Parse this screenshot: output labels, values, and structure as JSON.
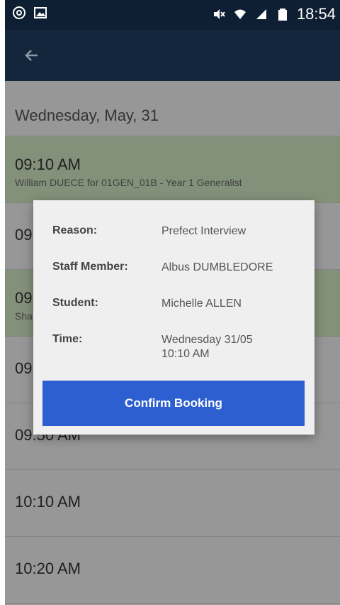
{
  "status_bar": {
    "time": "18:54",
    "icons": [
      "app-icon",
      "image-icon",
      "mute-icon",
      "wifi-icon",
      "signal-icon",
      "battery-icon"
    ]
  },
  "app_bar": {
    "back_icon": "arrow-left-icon"
  },
  "schedule": {
    "date": "Wednesday, May, 31",
    "slots": [
      {
        "time": "09:10 AM",
        "description": "William DUECE for 01GEN_01B - Year 1 Generalist",
        "booked": true
      },
      {
        "time": "09",
        "description": "",
        "booked": false
      },
      {
        "time": "09",
        "description": "Sha",
        "booked": true
      },
      {
        "time": "09",
        "description": "",
        "booked": false
      },
      {
        "time": "09:50 AM",
        "description": "",
        "booked": false
      },
      {
        "time": "10:10 AM",
        "description": "",
        "booked": false
      },
      {
        "time": "10:20 AM",
        "description": "",
        "booked": false
      }
    ]
  },
  "dialog": {
    "reason_label": "Reason:",
    "reason_value": "Prefect Interview",
    "staff_label": "Staff Member:",
    "staff_value": "Albus DUMBLEDORE",
    "student_label": "Student:",
    "student_value": "Michelle ALLEN",
    "time_label": "Time:",
    "time_value_line1": "Wednesday 31/05",
    "time_value_line2": "10:10 AM",
    "confirm_label": "Confirm Booking"
  },
  "colors": {
    "header": "#13263b",
    "booked_slot": "#d4ebc6",
    "confirm_button": "#2e5fd0"
  }
}
